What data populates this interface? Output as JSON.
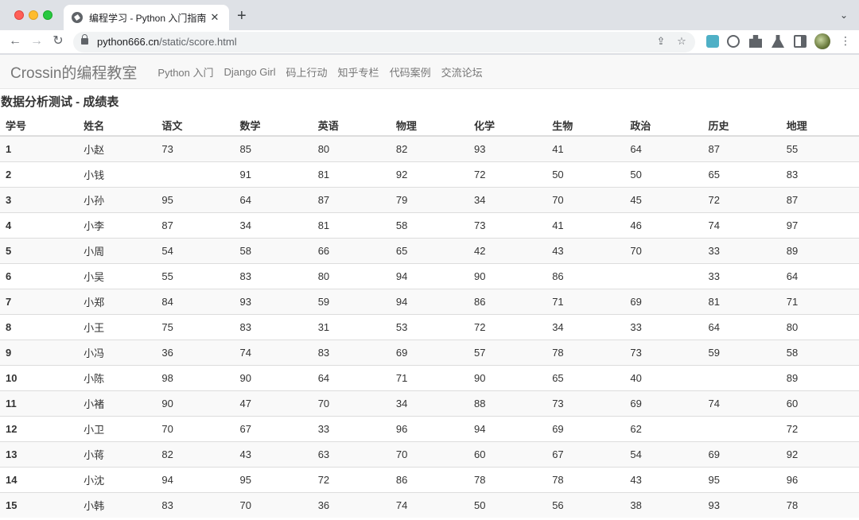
{
  "browser": {
    "tab_title": "编程学习 - Python 入门指南",
    "tab_close": "✕",
    "new_tab": "+",
    "tab_menu": "⌄",
    "url_host": "python666.cn",
    "url_path": "/static/score.html",
    "back": "←",
    "forward": "→",
    "reload": "↻",
    "share": "⇪",
    "star": "☆",
    "menu": "⋮"
  },
  "site": {
    "brand": "Crossin的编程教室",
    "nav": [
      "Python 入门",
      "Django Girl",
      "码上行动",
      "知乎专栏",
      "代码案例",
      "交流论坛"
    ],
    "title": "数据分析测试 - 成绩表"
  },
  "table": {
    "headers": [
      "学号",
      "姓名",
      "语文",
      "数学",
      "英语",
      "物理",
      "化学",
      "生物",
      "政治",
      "历史",
      "地理"
    ],
    "rows": [
      [
        "1",
        "小赵",
        "73",
        "85",
        "80",
        "82",
        "93",
        "41",
        "64",
        "87",
        "55"
      ],
      [
        "2",
        "小钱",
        "",
        "91",
        "81",
        "92",
        "72",
        "50",
        "50",
        "65",
        "83"
      ],
      [
        "3",
        "小孙",
        "95",
        "64",
        "87",
        "79",
        "34",
        "70",
        "45",
        "72",
        "87"
      ],
      [
        "4",
        "小李",
        "87",
        "34",
        "81",
        "58",
        "73",
        "41",
        "46",
        "74",
        "97"
      ],
      [
        "5",
        "小周",
        "54",
        "58",
        "66",
        "65",
        "42",
        "43",
        "70",
        "33",
        "89"
      ],
      [
        "6",
        "小吴",
        "55",
        "83",
        "80",
        "94",
        "90",
        "86",
        "",
        "33",
        "64"
      ],
      [
        "7",
        "小郑",
        "84",
        "93",
        "59",
        "94",
        "86",
        "71",
        "69",
        "81",
        "71"
      ],
      [
        "8",
        "小王",
        "75",
        "83",
        "31",
        "53",
        "72",
        "34",
        "33",
        "64",
        "80"
      ],
      [
        "9",
        "小冯",
        "36",
        "74",
        "83",
        "69",
        "57",
        "78",
        "73",
        "59",
        "58"
      ],
      [
        "10",
        "小陈",
        "98",
        "90",
        "64",
        "71",
        "90",
        "65",
        "40",
        "",
        "89"
      ],
      [
        "11",
        "小褚",
        "90",
        "47",
        "70",
        "34",
        "88",
        "73",
        "69",
        "74",
        "60"
      ],
      [
        "12",
        "小卫",
        "70",
        "67",
        "33",
        "96",
        "94",
        "69",
        "62",
        "",
        "72"
      ],
      [
        "13",
        "小蒋",
        "82",
        "43",
        "63",
        "70",
        "60",
        "67",
        "54",
        "69",
        "92"
      ],
      [
        "14",
        "小沈",
        "94",
        "95",
        "72",
        "86",
        "78",
        "78",
        "43",
        "95",
        "96"
      ],
      [
        "15",
        "小韩",
        "83",
        "70",
        "36",
        "74",
        "50",
        "56",
        "38",
        "93",
        "78"
      ]
    ]
  }
}
